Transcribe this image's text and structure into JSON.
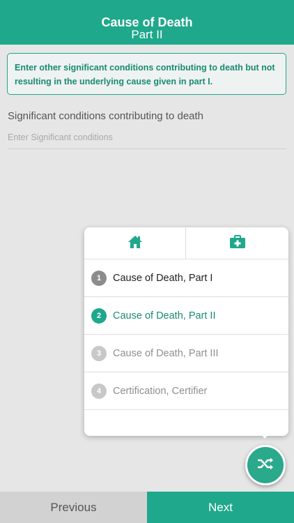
{
  "header": {
    "title": "Cause of Death",
    "subtitle": "Part II"
  },
  "instruction": "Enter other significant conditions contributing to death but not resulting in the underlying cause given in part I.",
  "field": {
    "label": "Significant conditions contributing to death",
    "placeholder": "Enter Significant conditions",
    "value": ""
  },
  "popup": {
    "tabs": [
      {
        "icon": "home-icon"
      },
      {
        "icon": "medical-kit-icon"
      }
    ],
    "steps": [
      {
        "number": "1",
        "label": "Cause of Death, Part I",
        "state": "completed",
        "badge_color": "#8c8c8c",
        "text_color": "#222222"
      },
      {
        "number": "2",
        "label": "Cause of Death, Part II",
        "state": "current",
        "badge_color": "#1fa88b",
        "text_color": "#1a8a73"
      },
      {
        "number": "3",
        "label": "Cause of Death, Part III",
        "state": "pending",
        "badge_color": "#c8c8c8",
        "text_color": "#8f8f8f"
      },
      {
        "number": "4",
        "label": "Certification, Certifier",
        "state": "pending",
        "badge_color": "#c8c8c8",
        "text_color": "#8f8f8f"
      }
    ]
  },
  "fab": {
    "icon": "shuffle-icon"
  },
  "footer": {
    "previous_label": "Previous",
    "next_label": "Next"
  },
  "colors": {
    "accent": "#1fa88b",
    "background": "#e6e6e6"
  }
}
